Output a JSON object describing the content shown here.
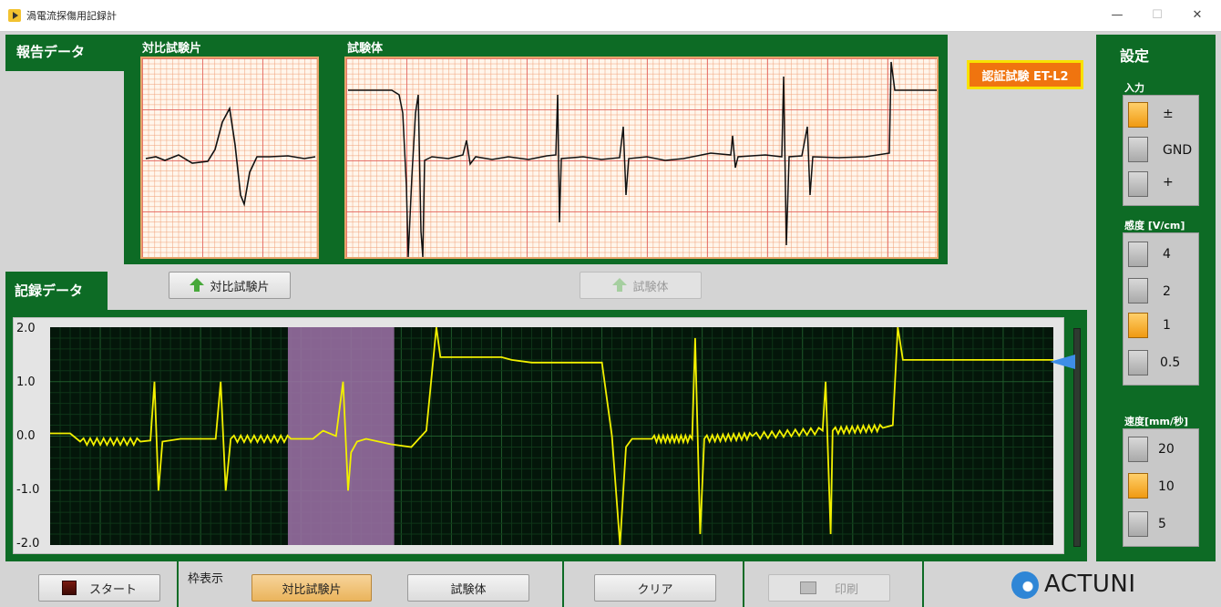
{
  "window": {
    "title": "渦電流探傷用記録計",
    "minimize": "—",
    "maximize": "☐",
    "close": "✕"
  },
  "report": {
    "tab_label": "報告データ",
    "compare_label": "対比試験片",
    "specimen_label": "試験体",
    "btn_compare": "対比試験片",
    "btn_specimen": "試験体"
  },
  "badge": "認証試験 ET-L2",
  "record": {
    "tab_label": "記録データ",
    "yticks": [
      "2.0",
      "1.0",
      "0.0",
      "-1.0",
      "-2.0"
    ]
  },
  "settings": {
    "title": "設定",
    "input": {
      "label": "入力",
      "options": [
        "±",
        "GND",
        "+"
      ],
      "selected": 0
    },
    "sensitivity": {
      "label": "感度 [V/cm]",
      "options": [
        "4",
        "2",
        "1",
        "0.5"
      ],
      "selected": 2
    },
    "speed": {
      "label": "速度[mm/秒]",
      "options": [
        "20",
        "10",
        "5"
      ],
      "selected": 1
    }
  },
  "bottom": {
    "start": "スタート",
    "frame_label": "枠表示",
    "btn_compare": "対比試験片",
    "btn_specimen": "試験体",
    "btn_clear": "クリア",
    "btn_print": "印刷",
    "logo": "ACTUNI"
  },
  "chart_data": {
    "type": "line",
    "title": "",
    "xlabel": "",
    "ylabel": "",
    "ylim": [
      -2.0,
      2.0
    ],
    "yticks": [
      2.0,
      1.0,
      0.0,
      -1.0,
      -2.0
    ],
    "grid": true,
    "highlight_x_range": [
      0.237,
      0.343
    ],
    "series": [
      {
        "color": "#f2f000",
        "x": [
          0,
          0.02,
          0.03,
          0.09,
          0.1,
          0.104,
          0.108,
          0.112,
          0.13,
          0.165,
          0.17,
          0.175,
          0.18,
          0.24,
          0.262,
          0.272,
          0.285,
          0.292,
          0.297,
          0.3,
          0.306,
          0.315,
          0.34,
          0.36,
          0.375,
          0.385,
          0.389,
          0.394,
          0.45,
          0.46,
          0.48,
          0.55,
          0.56,
          0.568,
          0.574,
          0.58,
          0.6,
          0.64,
          0.643,
          0.648,
          0.652,
          0.7,
          0.77,
          0.773,
          0.778,
          0.78,
          0.83,
          0.84,
          0.845,
          0.85,
          0.86,
          0.863,
          0.867,
          0.87,
          1.0
        ],
        "y": [
          0.05,
          0.05,
          -0.1,
          -0.1,
          -0.08,
          1.0,
          -1.0,
          -0.1,
          -0.05,
          -0.05,
          1.0,
          -1.0,
          -0.05,
          -0.05,
          -0.05,
          0.1,
          0.0,
          1.0,
          -1.0,
          -0.3,
          -0.1,
          -0.05,
          -0.15,
          -0.2,
          0.1,
          2.0,
          1.45,
          1.45,
          1.45,
          1.4,
          1.35,
          1.35,
          0.0,
          -2.0,
          -0.2,
          -0.05,
          -0.05,
          -0.05,
          1.8,
          -1.8,
          -0.05,
          0.0,
          0.1,
          1.0,
          -1.8,
          0.1,
          0.15,
          0.2,
          2.0,
          1.4,
          1.4,
          1.4,
          1.4,
          1.4,
          1.4
        ]
      }
    ]
  }
}
